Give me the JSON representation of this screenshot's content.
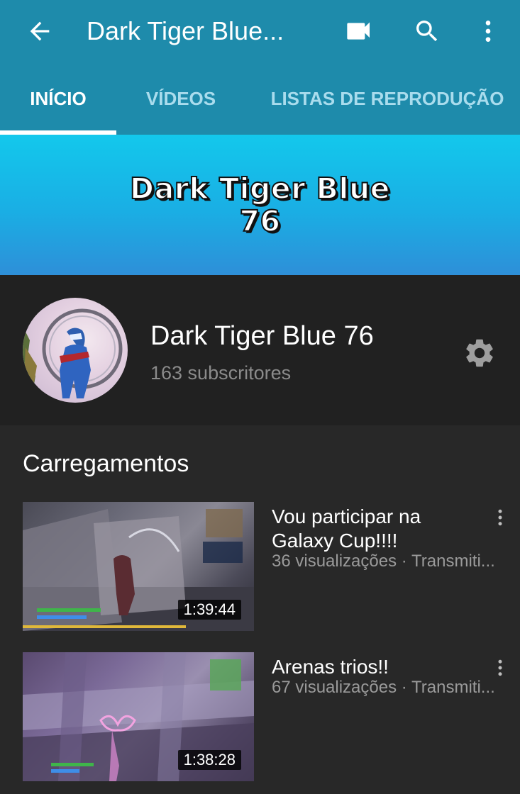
{
  "header": {
    "title": "Dark Tiger Blue...",
    "icons": [
      "arrow-back-icon",
      "video-camera-icon",
      "search-icon",
      "more-vert-icon"
    ]
  },
  "tabs": [
    {
      "label": "INÍCIO",
      "active": true
    },
    {
      "label": "VÍDEOS",
      "active": false
    },
    {
      "label": "LISTAS DE REPRODUÇÃO",
      "active": false
    }
  ],
  "banner": {
    "line1": "Dark Tiger Blue",
    "line2": "76"
  },
  "channel": {
    "name": "Dark Tiger Blue 76",
    "subscribers": "163 subscritores"
  },
  "section": {
    "title": "Carregamentos"
  },
  "videos": [
    {
      "title": "Vou participar na Galaxy Cup!!!!",
      "meta": "36 visualizações · Transmiti...",
      "duration": "1:39:44"
    },
    {
      "title": "Arenas trios!!",
      "meta": "67 visualizações · Transmiti...",
      "duration": "1:38:28"
    }
  ],
  "colors": {
    "appbar": "#1e8bab",
    "tab_inactive": "#a9dced",
    "background": "#282828",
    "channel_bg": "#212121"
  }
}
